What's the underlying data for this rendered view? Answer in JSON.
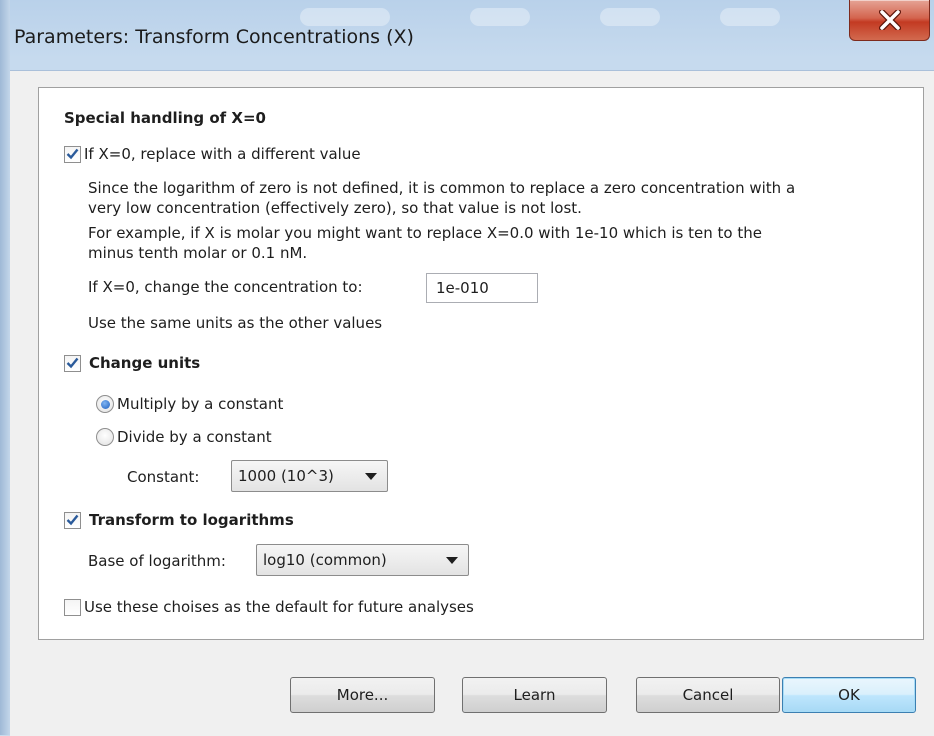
{
  "window": {
    "title": "Parameters: Transform Concentrations (X)"
  },
  "section_zero": {
    "heading": "Special handling of X=0",
    "replace_checkbox": {
      "label": "If X=0, replace with a different value",
      "checked": true
    },
    "explanation_lines": [
      "Since the logarithm of zero is not defined, it is common to replace a zero concentration with a",
      "very low concentration (effectively zero), so that value is not lost.",
      "For example, if X is molar you might want to replace X=0.0 with 1e-10 which is ten to the",
      "minus tenth molar or  0.1 nM."
    ],
    "change_label": "If X=0, change the concentration to:",
    "change_value": "1e-010",
    "units_note": "Use the same units as the other values"
  },
  "section_units": {
    "checkbox": {
      "label": "Change units",
      "checked": true
    },
    "multiply": {
      "label": "Multiply by a constant",
      "selected": true
    },
    "divide": {
      "label": "Divide by a constant",
      "selected": false
    },
    "constant_label": "Constant:",
    "constant_value": "1000 (10^3)"
  },
  "section_log": {
    "checkbox": {
      "label": "Transform to logarithms",
      "checked": true
    },
    "base_label": "Base of logarithm:",
    "base_value": "log10 (common)"
  },
  "default_checkbox": {
    "label": "Use these choises as the default for future analyses",
    "checked": false
  },
  "buttons": {
    "more": "More...",
    "learn": "Learn",
    "cancel": "Cancel",
    "ok": "OK"
  },
  "colors": {
    "close_button": "#c33a22",
    "check_mark": "#2a5a9a",
    "radio_selected": "#1d5fbf"
  }
}
